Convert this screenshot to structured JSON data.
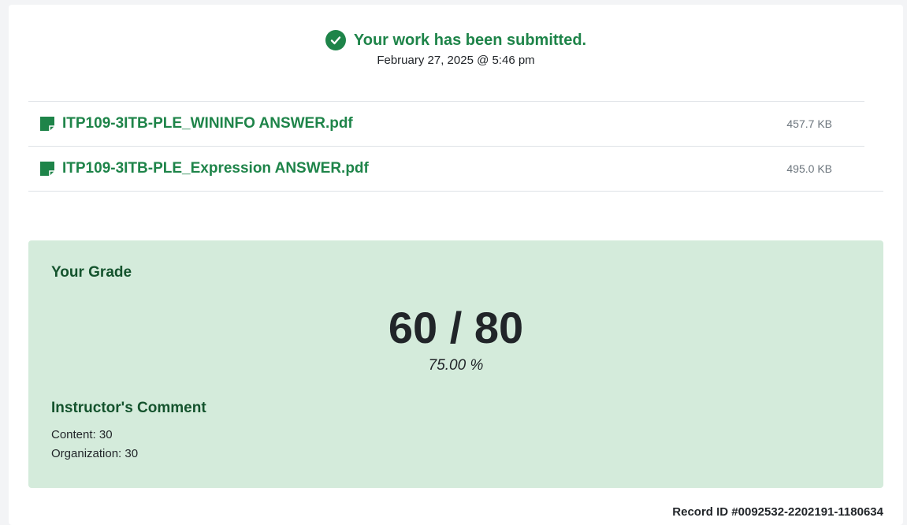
{
  "submission": {
    "status_text": "Your work has been submitted.",
    "submitted_at": "February 27, 2025 @ 5:46 pm",
    "icon": "check-circle-icon",
    "accent_color": "#1e8449"
  },
  "files": [
    {
      "name": "ITP109-3ITB-PLE_WININFO ANSWER.pdf",
      "size": "457.7 KB",
      "icon": "file-icon"
    },
    {
      "name": "ITP109-3ITB-PLE_Expression ANSWER.pdf",
      "size": "495.0 KB",
      "icon": "file-icon"
    }
  ],
  "grade": {
    "heading": "Your Grade",
    "score": "60 / 80",
    "percent": "75.00 %",
    "background_color": "#d4ebdb"
  },
  "comment": {
    "heading": "Instructor's Comment",
    "lines": [
      "Content: 30",
      "Organization: 30"
    ]
  },
  "record": {
    "id_text": "Record ID #0092532-2202191-1180634"
  }
}
